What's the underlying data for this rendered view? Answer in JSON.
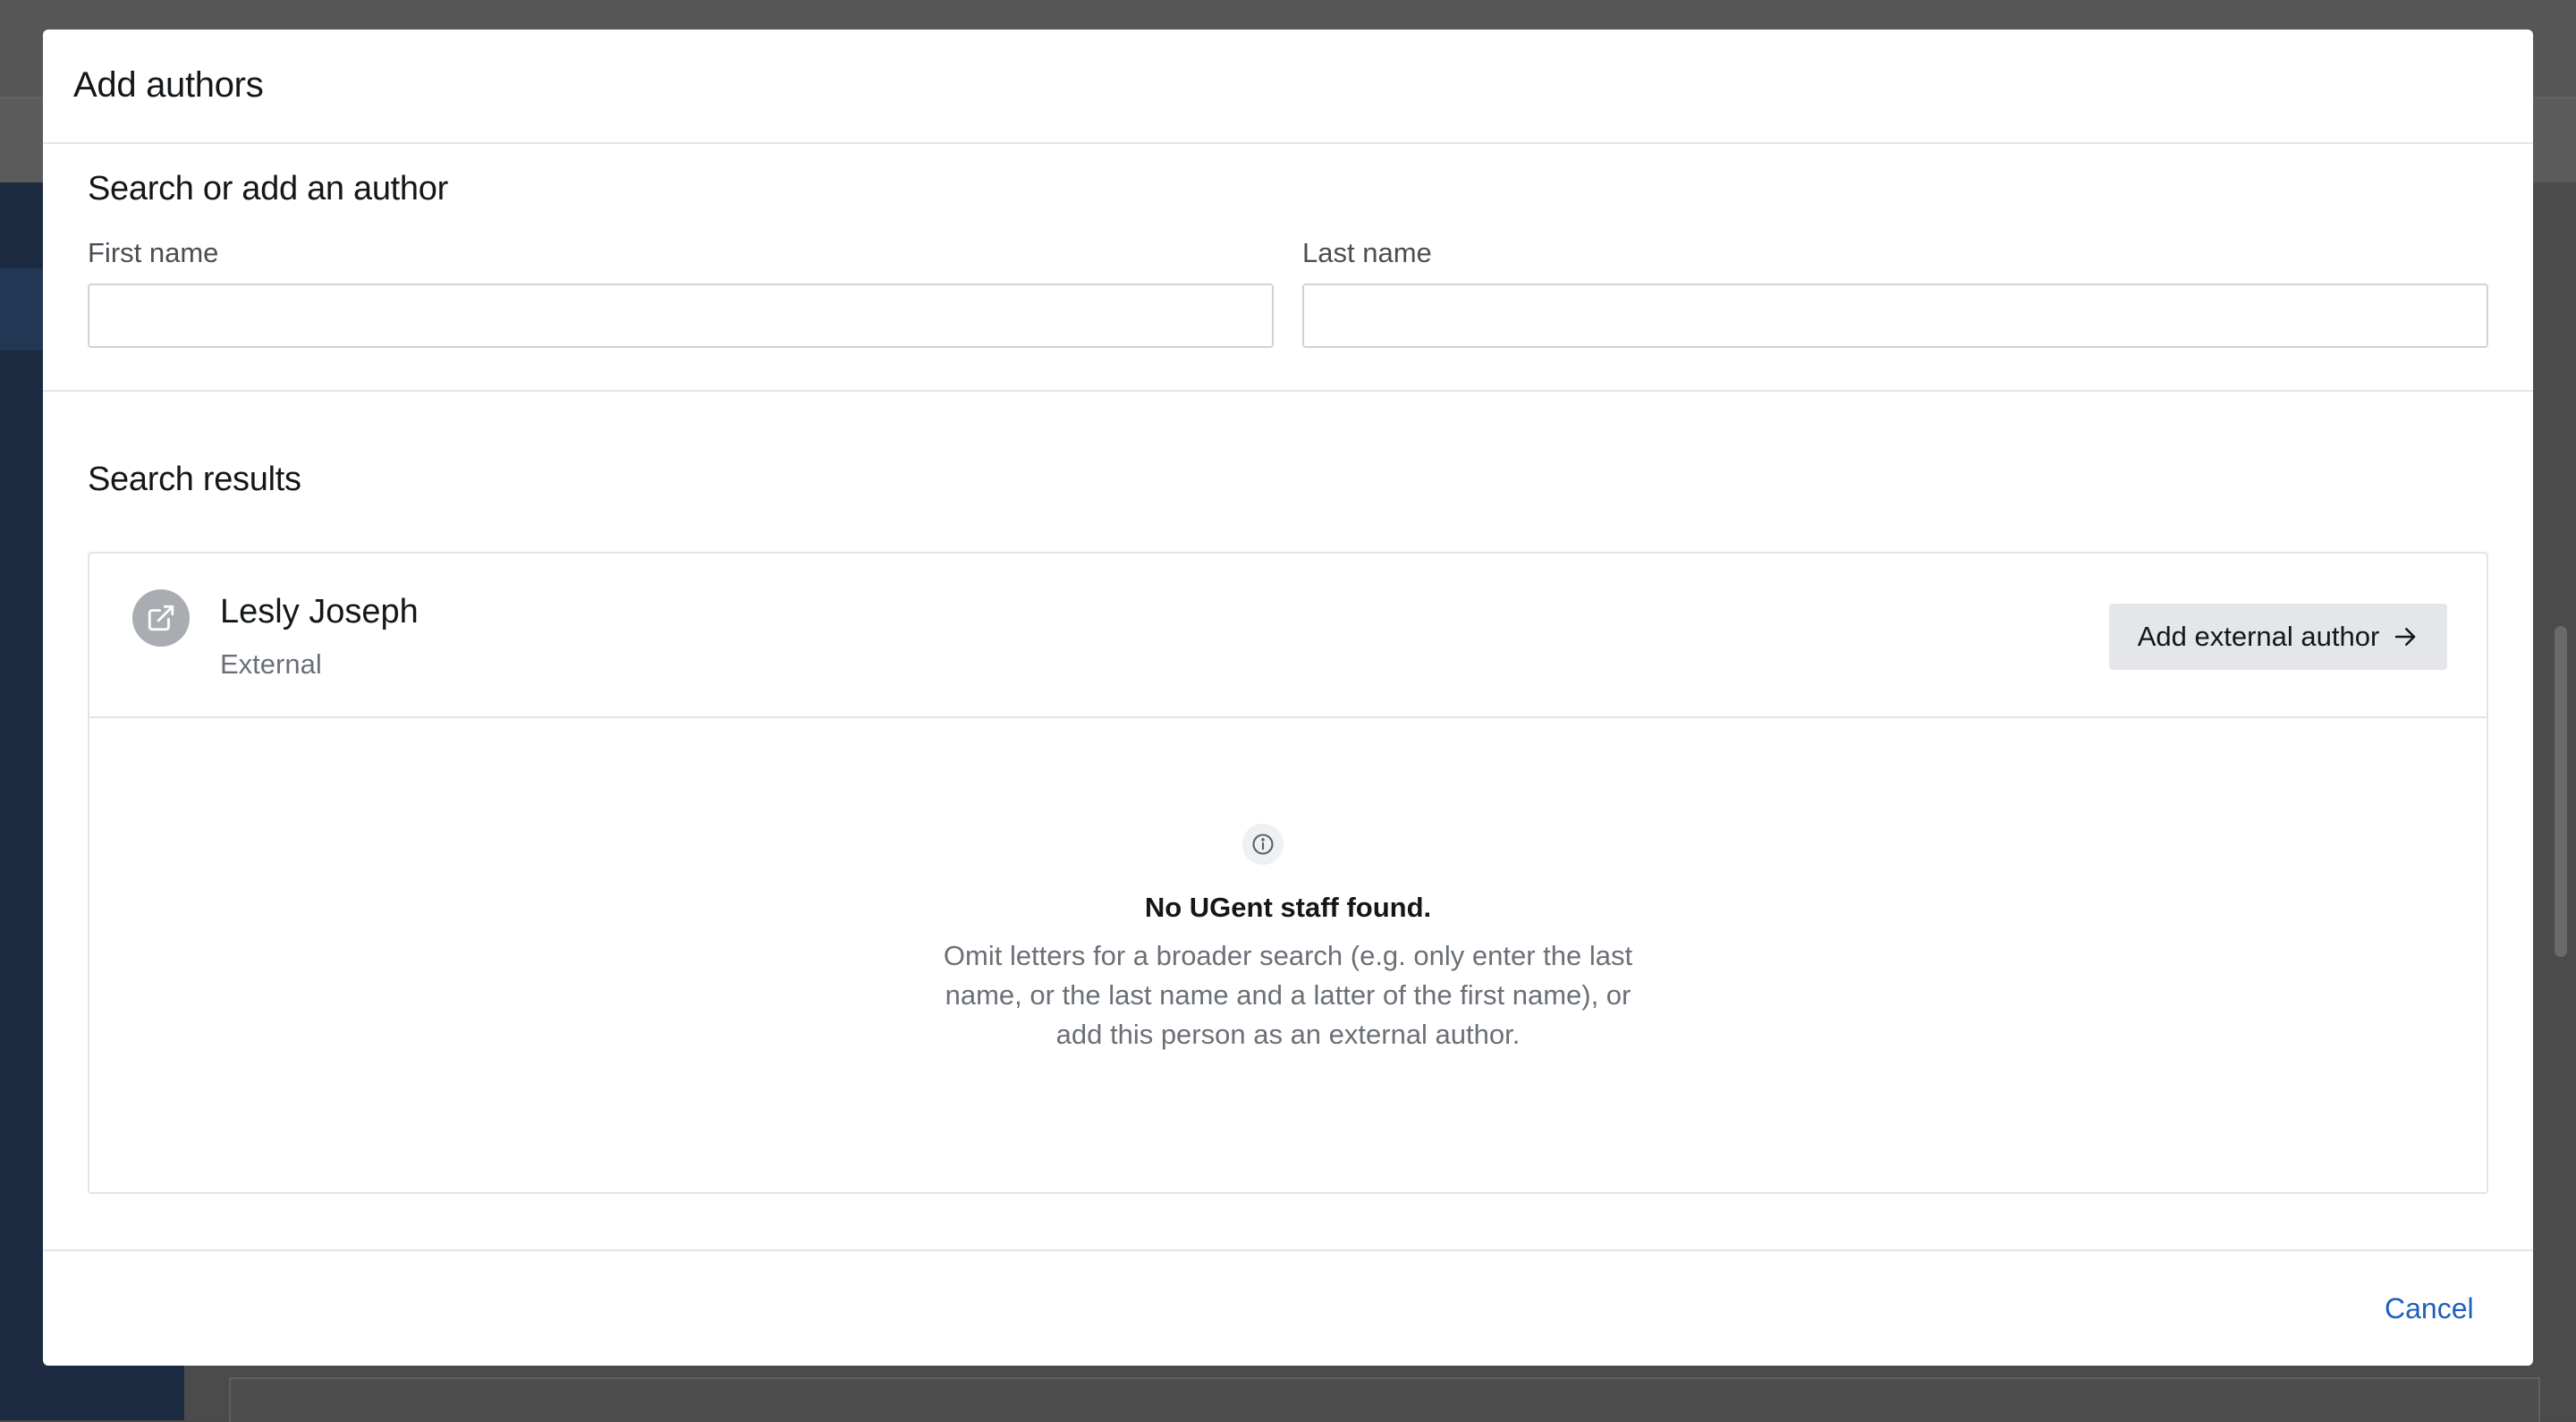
{
  "modal": {
    "title": "Add authors",
    "search_section_title": "Search or add an author",
    "first_name_label": "First name",
    "first_name_value": "",
    "last_name_label": "Last name",
    "last_name_value": "",
    "results_section_title": "Search results"
  },
  "result": {
    "name": "Lesly Joseph",
    "type": "External",
    "action_label": "Add external author",
    "avatar_icon": "external-link-icon",
    "action_icon": "arrow-right-icon"
  },
  "empty_state": {
    "icon": "info-icon",
    "title": "No UGent staff found.",
    "message": "Omit letters for a broader search (e.g. only enter the last name, or the last name and a latter of the first name), or add this person as an external author."
  },
  "footer": {
    "cancel_label": "Cancel"
  },
  "colors": {
    "link": "#1f5fbf",
    "button_bg": "#e4e6e9",
    "overlay": "#4a4a4a"
  }
}
